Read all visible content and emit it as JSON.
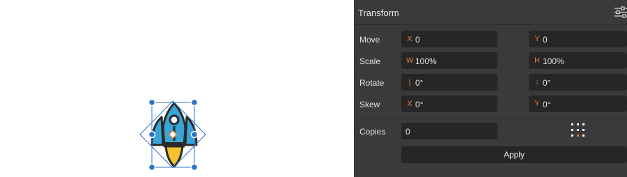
{
  "panel": {
    "title": "Transform",
    "rows": {
      "move": {
        "label": "Move",
        "a": {
          "tag": "X",
          "value": "0"
        },
        "b": {
          "tag": "Y",
          "value": "0"
        }
      },
      "scale": {
        "label": "Scale",
        "a": {
          "tag": "W",
          "value": "100%"
        },
        "b": {
          "tag": "H",
          "value": "100%"
        }
      },
      "rotate": {
        "label": "Rotate",
        "a": {
          "tag": "|",
          "value": "0°"
        },
        "b": {
          "tag": "↓",
          "value": "0°"
        }
      },
      "skew": {
        "label": "Skew",
        "a": {
          "tag": "X",
          "value": "0°"
        },
        "b": {
          "tag": "Y",
          "value": "0°"
        }
      }
    },
    "copies": {
      "label": "Copies",
      "value": "0"
    },
    "apply_label": "Apply"
  },
  "colors": {
    "accent": "#e8773b",
    "selection": "#2f73c9",
    "panel_bg": "#3a3a3a",
    "field_bg": "#262626"
  },
  "icons": {
    "canvas_object": "rocket-icon",
    "settings": "sliders-icon",
    "grid": "grid-dots-icon"
  }
}
